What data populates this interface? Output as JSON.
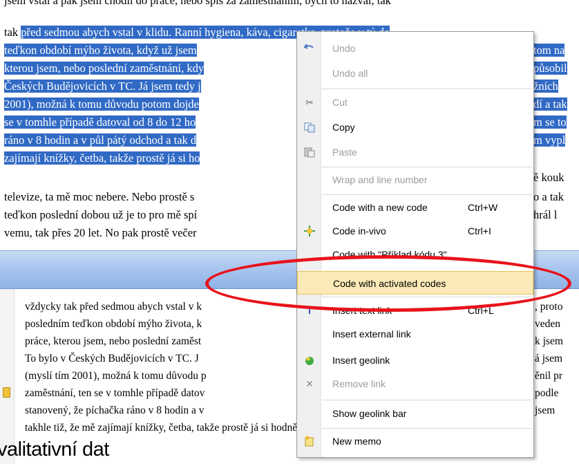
{
  "top_doc": {
    "line0": "jsem vstal a pak jsem chodil do práce, nebo spíš za zaměstnáním, bych to nazval, tak",
    "line1_pre": "tak ",
    "line1_sel": "před sedmou abych vstal v klidu. Ranní hygiena, káva, cigaretka, protože v tý do",
    "line2": "teďkon období mýho života, když už jsem",
    "line3": "kterou jsem, nebo poslední zaměstnání, kdy",
    "line4": "Českých Budějovicích v TC. Já jsem tedy j",
    "line5": "2001), možná k tomu důvodu potom dojde",
    "line6": "se v tomhle případě datoval od 8 do 12 ho",
    "line7": "ráno v 8 hodin a v půl pátý odchod a tak d",
    "line8": "zajímají knížky, četba, takže prostě já si ho",
    "line9": "televize, ta mě moc nebere. Nebo prostě s",
    "line10": "teďkon poslední dobou už je to pro mě spí",
    "line11": "vemu, tak přes 20 let. No pak prostě večer",
    "r2": "tom na",
    "r3": "působil",
    "r4": "žních ",
    "r5": "dí a tak",
    "r6": "m se to",
    "r7": "m vypl",
    "r8": "ě kouk",
    "r9": "o a tak",
    "r10": "hrál l"
  },
  "bottom_doc": {
    "line1": "vždycky tak před sedmou abych vstal v k",
    "line2": "posledním teďkon období mýho života, k",
    "line3": "práce, kterou jsem, nebo poslední zaměst",
    "line4": "To bylo v Českých Budějovicích v TC. J",
    "line5": "(myslí tím 2001), možná k tomu důvodu p",
    "line6": "zaměstnání, ten se v tomhle případě datov",
    "line7": "stanovený, že píchačka ráno v 8 hodin a v",
    "line8": "takhle tiž, že mě zajímají knížky, četba, takže prostě já si hodně čtu, popřípadě",
    "r1": ", proto",
    "r2": "veden",
    "r3": "k jsem",
    "r4": "á jsem",
    "r5": "ěnil pr",
    "r6": "podle",
    "r7": "jsem "
  },
  "corner_label": "valitativní dat",
  "context_menu": {
    "items": [
      {
        "label": "Undo",
        "shortcut": "",
        "icon": "undo-icon",
        "disabled": true
      },
      {
        "label": "Undo all",
        "shortcut": "",
        "icon": "",
        "disabled": true
      },
      {
        "label": "Cut",
        "shortcut": "",
        "icon": "scissors-icon",
        "disabled": true
      },
      {
        "label": "Copy",
        "shortcut": "",
        "icon": "copy-icon",
        "disabled": false
      },
      {
        "label": "Paste",
        "shortcut": "",
        "icon": "paste-icon",
        "disabled": true
      },
      {
        "label": "Wrap and line number",
        "shortcut": "",
        "icon": "",
        "disabled": true
      },
      {
        "label": "Code with a new code",
        "shortcut": "Ctrl+W",
        "icon": "",
        "disabled": false
      },
      {
        "label": "Code in-vivo",
        "shortcut": "Ctrl+I",
        "icon": "in-vivo-code-icon",
        "disabled": false
      },
      {
        "label": "Code with \"Příklad kódu 3\"",
        "shortcut": "",
        "icon": "",
        "disabled": false
      },
      {
        "label": "Code with activated codes",
        "shortcut": "",
        "icon": "",
        "disabled": false
      },
      {
        "label": "Insert text link",
        "shortcut": "Ctrl+L",
        "icon": "text-link-icon",
        "disabled": false
      },
      {
        "label": "Insert external link",
        "shortcut": "",
        "icon": "",
        "disabled": false
      },
      {
        "label": "Insert geolink",
        "shortcut": "",
        "icon": "geolink-icon",
        "disabled": false
      },
      {
        "label": "Remove link",
        "shortcut": "",
        "icon": "remove-link-icon",
        "disabled": true
      },
      {
        "label": "Show geolink bar",
        "shortcut": "",
        "icon": "",
        "disabled": false
      },
      {
        "label": "New memo",
        "shortcut": "",
        "icon": "memo-icon",
        "disabled": false
      }
    ]
  },
  "colors": {
    "selection": "#316ac5",
    "highlight": "#fbeab7",
    "annotation": "#e8131b",
    "disabled_text": "#9c9c9c"
  }
}
